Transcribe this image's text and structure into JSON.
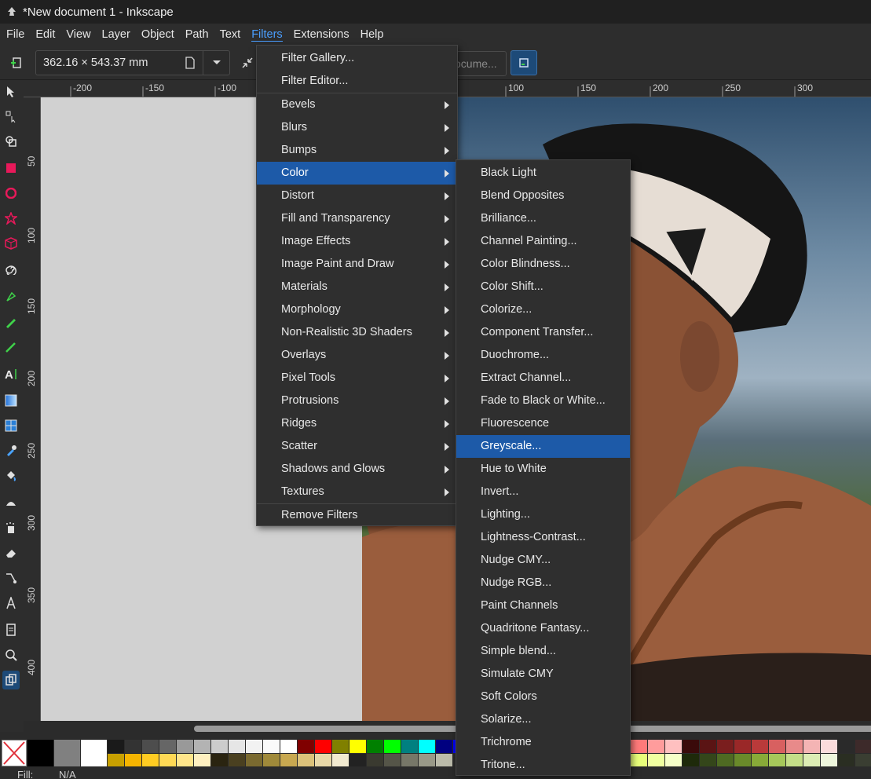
{
  "window": {
    "title": "*New document 1 - Inkscape"
  },
  "menubar": [
    "File",
    "Edit",
    "View",
    "Layer",
    "Object",
    "Path",
    "Text",
    "Filters",
    "Extensions",
    "Help"
  ],
  "toolbar": {
    "page_size": "362.16 × 543.37 mm",
    "document_placeholder": "ocume..."
  },
  "ruler": {
    "h_ticks": [
      "-200",
      "-150",
      "-100",
      "100",
      "150",
      "200",
      "250",
      "300"
    ],
    "v_ticks": [
      "50",
      "100",
      "150",
      "200",
      "250",
      "300",
      "350",
      "400"
    ]
  },
  "filters_menu": {
    "items": [
      {
        "label": "Filter Gallery..."
      },
      {
        "label": "Filter Editor..."
      },
      {
        "label": "Bevels",
        "submenu": true
      },
      {
        "label": "Blurs",
        "submenu": true
      },
      {
        "label": "Bumps",
        "submenu": true
      },
      {
        "label": "Color",
        "submenu": true,
        "highlighted": true
      },
      {
        "label": "Distort",
        "submenu": true
      },
      {
        "label": "Fill and Transparency",
        "submenu": true
      },
      {
        "label": "Image Effects",
        "submenu": true
      },
      {
        "label": "Image Paint and Draw",
        "submenu": true
      },
      {
        "label": "Materials",
        "submenu": true
      },
      {
        "label": "Morphology",
        "submenu": true
      },
      {
        "label": "Non-Realistic 3D Shaders",
        "submenu": true
      },
      {
        "label": "Overlays",
        "submenu": true
      },
      {
        "label": "Pixel Tools",
        "submenu": true
      },
      {
        "label": "Protrusions",
        "submenu": true
      },
      {
        "label": "Ridges",
        "submenu": true
      },
      {
        "label": "Scatter",
        "submenu": true
      },
      {
        "label": "Shadows and Glows",
        "submenu": true
      },
      {
        "label": "Textures",
        "submenu": true
      },
      {
        "label": "Remove Filters"
      }
    ]
  },
  "color_submenu": {
    "items": [
      "Black Light",
      "Blend Opposites",
      "Brilliance...",
      "Channel Painting...",
      "Color Blindness...",
      "Color Shift...",
      "Colorize...",
      "Component Transfer...",
      "Duochrome...",
      "Extract Channel...",
      "Fade to Black or White...",
      "Fluorescence",
      "Greyscale...",
      "Hue to White",
      "Invert...",
      "Lighting...",
      "Lightness-Contrast...",
      "Nudge CMY...",
      "Nudge RGB...",
      "Paint Channels",
      "Quadritone Fantasy...",
      "Simple blend...",
      "Simulate CMY",
      "Soft Colors",
      "Solarize...",
      "Trichrome",
      "Tritone..."
    ],
    "highlighted": "Greyscale..."
  },
  "status": {
    "fill_label": "Fill:",
    "fill_value": "N/A"
  },
  "colors": {
    "accent": "#1d5aa8",
    "menu_bg": "#2f2f2f",
    "menu_text": "#e8e8e8"
  }
}
